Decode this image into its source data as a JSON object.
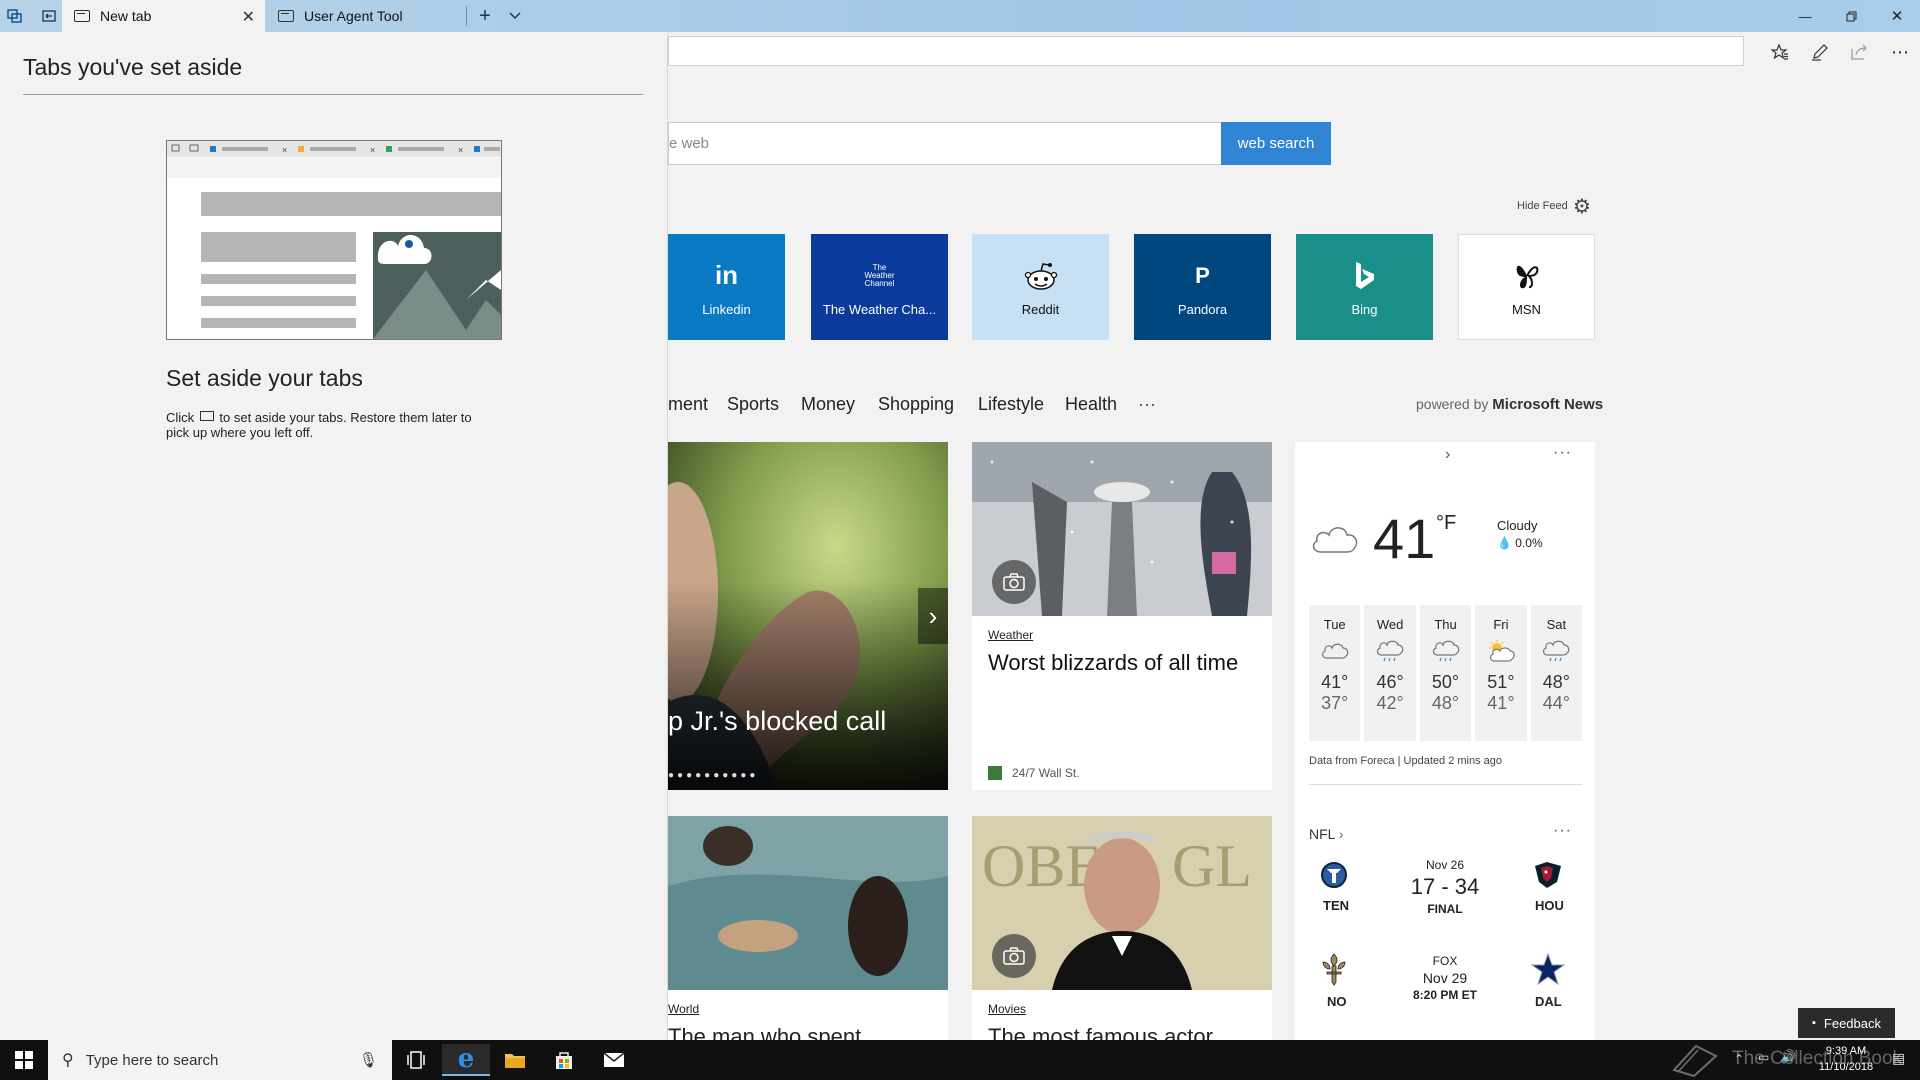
{
  "tabs": {
    "new_tab": "New tab",
    "user_agent": "User Agent Tool"
  },
  "toolbar": {
    "favorites_icon": "favorites-star-icon",
    "notes_icon": "pen-icon",
    "share_icon": "share-icon",
    "more_icon": "more-icon"
  },
  "page": {
    "search_placeholder": "e web",
    "search_button": "web search",
    "hide_feed": "Hide Feed",
    "tiles": [
      {
        "logo": "in",
        "label": "Linkedin",
        "color": "#0a79c4"
      },
      {
        "logo": "The Weather Channel",
        "label": "The Weather Cha...",
        "color": "#0a3a9a"
      },
      {
        "logo": "reddit",
        "label": "Reddit",
        "color": "#c6e0f5"
      },
      {
        "logo": "P",
        "label": "Pandora",
        "color": "#00467f"
      },
      {
        "logo": "b",
        "label": "Bing",
        "color": "#1a8f8a"
      },
      {
        "logo": "msn",
        "label": "MSN",
        "color": "#ffffff"
      }
    ],
    "nav": [
      "ment",
      "Sports",
      "Money",
      "Shopping",
      "Lifestyle",
      "Health",
      "···"
    ],
    "powered_by": "powered by",
    "powered_brand": "Microsoft News",
    "hero_headline": "p Jr.'s blocked call",
    "card_weather": {
      "category": "Weather",
      "headline": "Worst blizzards of all time",
      "source": "24/7 Wall St."
    },
    "card_world": {
      "category": "World",
      "headline": "The man who spent"
    },
    "card_movies": {
      "category": "Movies",
      "headline": "The most famous actor"
    }
  },
  "weather": {
    "temp": "41",
    "unit": "°F",
    "condition": "Cloudy",
    "precip": "0.0%",
    "days": [
      {
        "day": "Tue",
        "hi": "41°",
        "lo": "37°"
      },
      {
        "day": "Wed",
        "hi": "46°",
        "lo": "42°"
      },
      {
        "day": "Thu",
        "hi": "50°",
        "lo": "48°"
      },
      {
        "day": "Fri",
        "hi": "51°",
        "lo": "41°"
      },
      {
        "day": "Sat",
        "hi": "48°",
        "lo": "44°"
      }
    ],
    "footer": "Data from Foreca | Updated 2 mins ago"
  },
  "nfl": {
    "title": "NFL",
    "game1": {
      "home": "TEN",
      "away": "HOU",
      "date": "Nov 26",
      "score": "17 - 34",
      "status": "FINAL"
    },
    "game2": {
      "home": "NO",
      "away": "DAL",
      "network": "FOX",
      "date": "Nov 29",
      "time": "8:20 PM ET"
    }
  },
  "panel": {
    "title": "Tabs you've set aside",
    "subtitle": "Set aside your tabs",
    "text_before": "Click",
    "text_after": "to set aside your tabs. Restore them later to pick up where you left off."
  },
  "taskbar": {
    "search_placeholder": "Type here to search",
    "time": "9:39 AM",
    "date": "11/10/2018",
    "feedback": "Feedback",
    "watermark": "The Collection Book"
  }
}
